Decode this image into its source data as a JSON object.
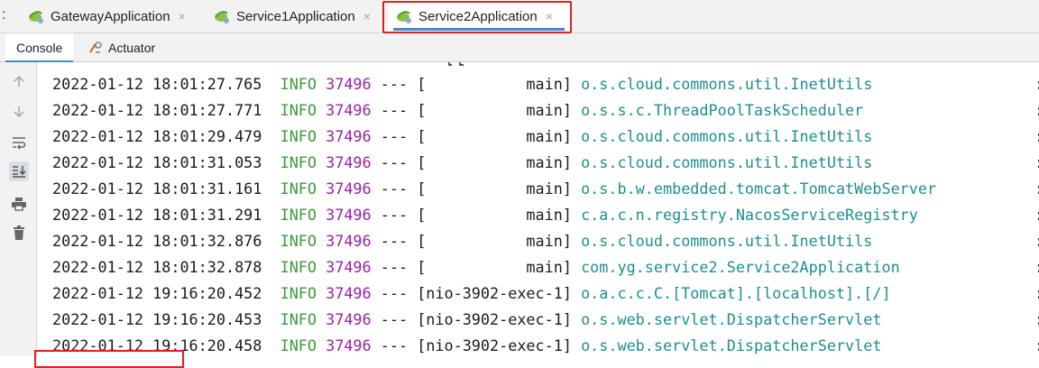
{
  "run_tabs": {
    "prefix": ":",
    "tabs": [
      {
        "label": "GatewayApplication",
        "close": "×"
      },
      {
        "label": "Service1Application",
        "close": "×"
      },
      {
        "label": "Service2Application",
        "close": "×",
        "active": true
      }
    ]
  },
  "sub_tabs": {
    "console": "Console",
    "actuator": "Actuator"
  },
  "toolbar": {
    "icons": [
      "up-arrow-icon",
      "down-arrow-icon",
      "soft-wrap-icon",
      "scroll-to-end-icon",
      "print-icon",
      "trash-icon"
    ]
  },
  "colors": {
    "info_level": "#3c9a3c",
    "pid": "#9b22a3",
    "logger": "#1e8e8e",
    "tab_underline": "#4a86c8",
    "highlight": "#e02020"
  },
  "log": {
    "lines": [
      {
        "ts": "2022-01-12 18:01:27.765",
        "level": "INFO",
        "pid": "37496",
        "sep": "---",
        "thread": "[           main]",
        "logger": "o.s.cloud.commons.util.InetUtils",
        "colon": ":"
      },
      {
        "ts": "2022-01-12 18:01:27.771",
        "level": "INFO",
        "pid": "37496",
        "sep": "---",
        "thread": "[           main]",
        "logger": "o.s.s.c.ThreadPoolTaskScheduler",
        "colon": ":"
      },
      {
        "ts": "2022-01-12 18:01:29.479",
        "level": "INFO",
        "pid": "37496",
        "sep": "---",
        "thread": "[           main]",
        "logger": "o.s.cloud.commons.util.InetUtils",
        "colon": ":"
      },
      {
        "ts": "2022-01-12 18:01:31.053",
        "level": "INFO",
        "pid": "37496",
        "sep": "---",
        "thread": "[           main]",
        "logger": "o.s.cloud.commons.util.InetUtils",
        "colon": ":"
      },
      {
        "ts": "2022-01-12 18:01:31.161",
        "level": "INFO",
        "pid": "37496",
        "sep": "---",
        "thread": "[           main]",
        "logger": "o.s.b.w.embedded.tomcat.TomcatWebServer",
        "colon": ":"
      },
      {
        "ts": "2022-01-12 18:01:31.291",
        "level": "INFO",
        "pid": "37496",
        "sep": "---",
        "thread": "[           main]",
        "logger": "c.a.c.n.registry.NacosServiceRegistry",
        "colon": ":"
      },
      {
        "ts": "2022-01-12 18:01:32.876",
        "level": "INFO",
        "pid": "37496",
        "sep": "---",
        "thread": "[           main]",
        "logger": "o.s.cloud.commons.util.InetUtils",
        "colon": ":"
      },
      {
        "ts": "2022-01-12 18:01:32.878",
        "level": "INFO",
        "pid": "37496",
        "sep": "---",
        "thread": "[           main]",
        "logger": "com.yg.service2.Service2Application",
        "colon": ":"
      },
      {
        "ts": "2022-01-12 19:16:20.452",
        "level": "INFO",
        "pid": "37496",
        "sep": "---",
        "thread": "[nio-3902-exec-1]",
        "logger": "o.a.c.c.C.[Tomcat].[localhost].[/]",
        "colon": ":"
      },
      {
        "ts": "2022-01-12 19:16:20.453",
        "level": "INFO",
        "pid": "37496",
        "sep": "---",
        "thread": "[nio-3902-exec-1]",
        "logger": "o.s.web.servlet.DispatcherServlet",
        "colon": ":"
      },
      {
        "ts": "2022-01-12 19:16:20.458",
        "level": "INFO",
        "pid": "37496",
        "sep": "---",
        "thread": "[nio-3902-exec-1]",
        "logger": "o.s.web.servlet.DispatcherServlet",
        "colon": ":"
      }
    ]
  }
}
